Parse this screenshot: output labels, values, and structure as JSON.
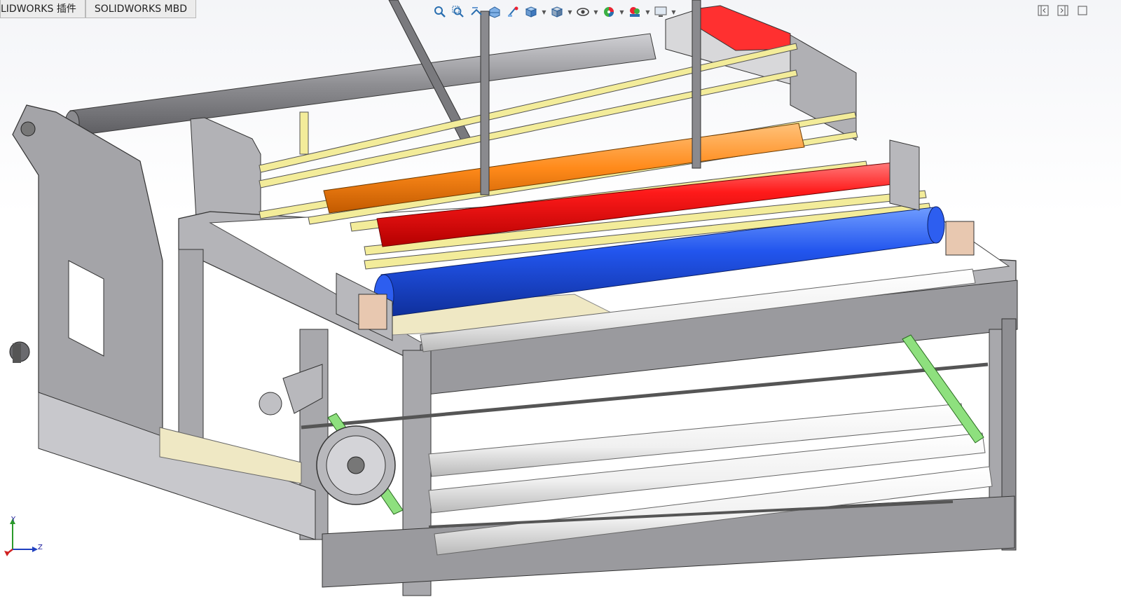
{
  "tabs": [
    {
      "label": "LIDWORKS 插件"
    },
    {
      "label": "SOLIDWORKS MBD"
    }
  ],
  "heads_up_toolbar": [
    {
      "icon": "zoom-to-fit-icon"
    },
    {
      "icon": "zoom-to-area-icon"
    },
    {
      "icon": "previous-view-icon"
    },
    {
      "icon": "section-view-icon"
    },
    {
      "icon": "dynamic-annotation-icon"
    },
    {
      "icon": "view-orientation-icon"
    },
    {
      "icon": "display-style-icon"
    },
    {
      "icon": "hide-show-items-icon"
    },
    {
      "icon": "edit-appearance-icon"
    },
    {
      "icon": "apply-scene-icon"
    },
    {
      "icon": "view-settings-icon"
    }
  ],
  "triad": {
    "x_label": "",
    "y_label": "Y",
    "z_label": "Z"
  },
  "colors": {
    "frame": "#a9a9ad",
    "frame_dark": "#6f6f73",
    "red_roller": "#ff1010",
    "blue_roller": "#1f4fe6",
    "orange_roller": "#ff8a1a",
    "yellow_rod": "#f3ec9a",
    "green_link": "#8ee07e",
    "white_roller": "#f2f2f2",
    "beige_bed": "#efe8c4"
  }
}
